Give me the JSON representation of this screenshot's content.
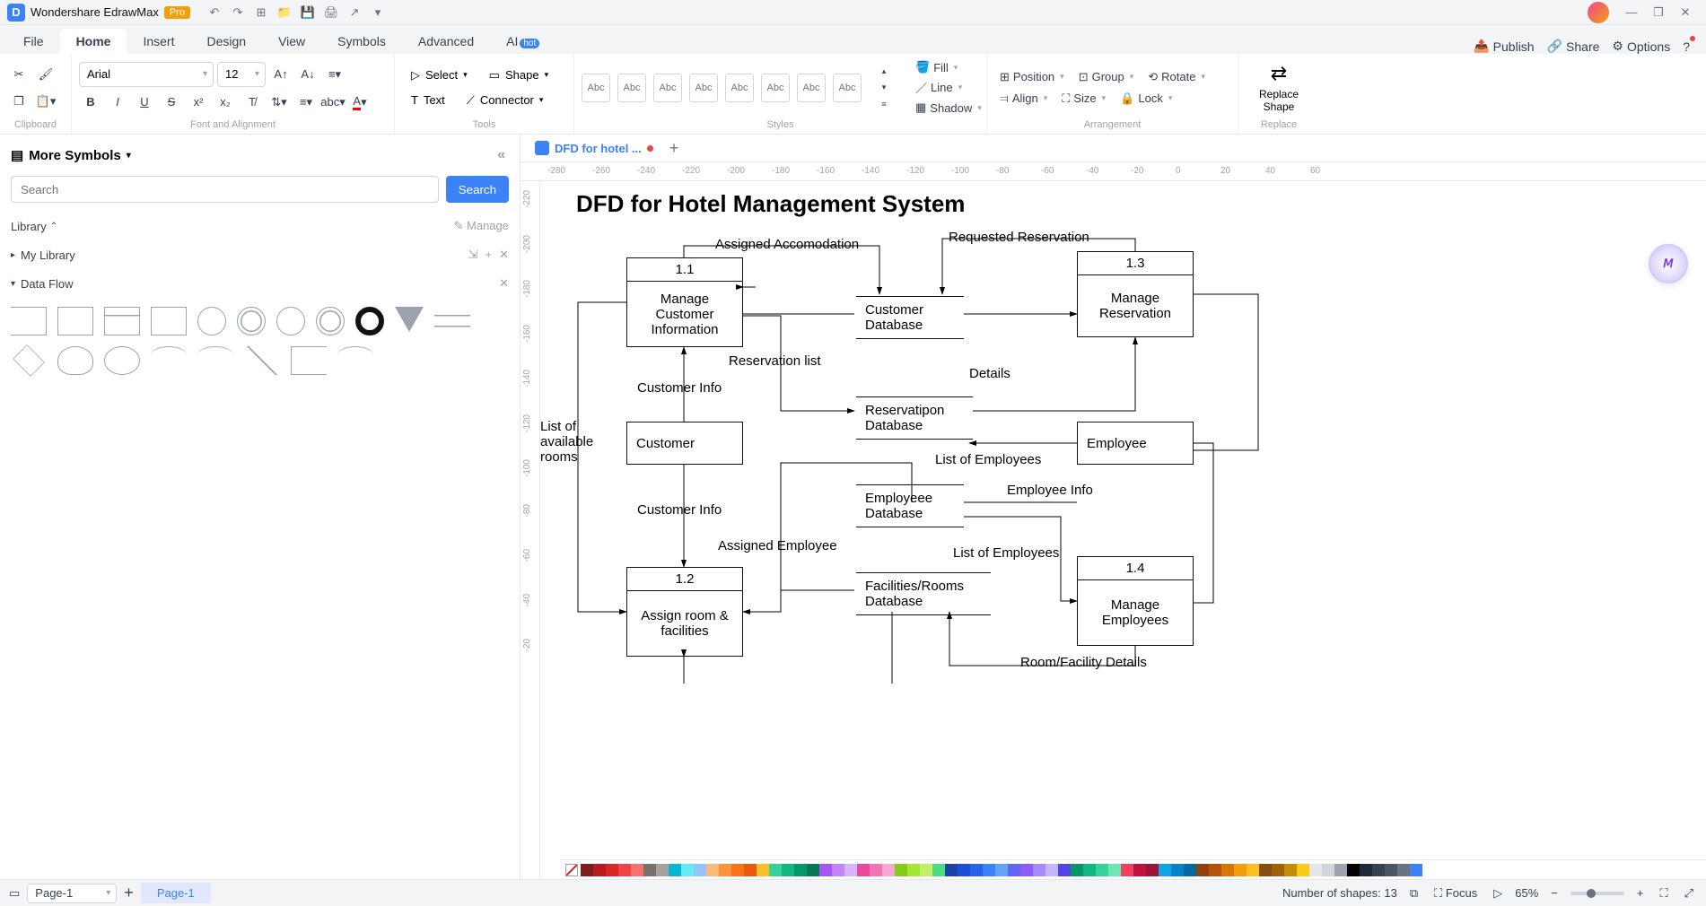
{
  "app": {
    "name": "Wondershare EdrawMax",
    "badge": "Pro"
  },
  "titlebar_icons": [
    "undo",
    "redo",
    "new",
    "open",
    "save",
    "print",
    "export",
    "more"
  ],
  "menu": {
    "items": [
      "File",
      "Home",
      "Insert",
      "Design",
      "View",
      "Symbols",
      "Advanced",
      "AI"
    ],
    "active": "Home",
    "hot_on": "AI",
    "right": {
      "publish": "Publish",
      "share": "Share",
      "options": "Options"
    }
  },
  "ribbon": {
    "clipboard": {
      "label": "Clipboard"
    },
    "font": {
      "label": "Font and Alignment",
      "family": "Arial",
      "size": "12"
    },
    "tools": {
      "label": "Tools",
      "select": "Select",
      "text": "Text",
      "shape": "Shape",
      "connector": "Connector"
    },
    "styles": {
      "label": "Styles",
      "sample": "Abc",
      "count": 8,
      "fill": "Fill",
      "line": "Line",
      "shadow": "Shadow"
    },
    "arrange": {
      "label": "Arrangement",
      "position": "Position",
      "align": "Align",
      "group": "Group",
      "size": "Size",
      "rotate": "Rotate",
      "lock": "Lock"
    },
    "replace": {
      "label": "Replace",
      "btn": "Replace Shape"
    }
  },
  "sidebar": {
    "title": "More Symbols",
    "search_placeholder": "Search",
    "search_btn": "Search",
    "library": "Library",
    "manage": "Manage",
    "mylib": "My Library",
    "section": "Data Flow"
  },
  "tab": {
    "name": "DFD for hotel ...",
    "dirty": true
  },
  "ruler_h": [
    "-280",
    "-260",
    "-240",
    "-220",
    "-200",
    "-180",
    "-160",
    "-140",
    "-120",
    "-100",
    "-80",
    "-60",
    "-40",
    "-20",
    "0",
    "20",
    "40",
    "60"
  ],
  "ruler_v": [
    "-220",
    "-200",
    "-180",
    "-160",
    "-140",
    "-120",
    "-100",
    "-80",
    "-60",
    "-40",
    "-20"
  ],
  "diagram": {
    "title": "DFD for Hotel Management System",
    "processes": {
      "p11": {
        "num": "1.1",
        "label": "Manage Customer Information"
      },
      "p12": {
        "num": "1.2",
        "label": "Assign room & facilities"
      },
      "p13": {
        "num": "1.3",
        "label": "Manage Reservation"
      },
      "p14": {
        "num": "1.4",
        "label": "Manage Employees"
      }
    },
    "entities": {
      "customer": "Customer",
      "employee": "Employee"
    },
    "stores": {
      "custdb": "Customer Database",
      "resdb": "Reservatipon Database",
      "empdb": "Employeee Database",
      "facdb": "Facilities/Rooms Database"
    },
    "flows": {
      "assigned_accom": "Assigned Accomodation",
      "requested_res": "Requested Reservation",
      "reservation_list": "Reservation list",
      "details": "Details",
      "customer_info1": "Customer Info",
      "customer_info2": "Customer Info",
      "list_rooms": "List of available rooms",
      "list_emp1": "List of Employees",
      "list_emp2": "List of Employees",
      "emp_info": "Employee Info",
      "assigned_emp": "Assigned Employee",
      "room_details": "Room/Facility Details"
    }
  },
  "status": {
    "page_sel": "Page-1",
    "page_tab": "Page-1",
    "shapes": "Number of shapes: 13",
    "focus": "Focus",
    "zoom": "65%"
  },
  "colors": [
    "#7f1d1d",
    "#b91c1c",
    "#dc2626",
    "#ef4444",
    "#f87171",
    "#78716c",
    "#a8a29e",
    "#06b6d4",
    "#67e8f9",
    "#93c5fd",
    "#fdba74",
    "#fb923c",
    "#f97316",
    "#ea580c",
    "#fbbf24",
    "#34d399",
    "#10b981",
    "#059669",
    "#047857",
    "#a855f7",
    "#c084fc",
    "#d8b4fe",
    "#ec4899",
    "#f472b6",
    "#f9a8d4",
    "#84cc16",
    "#a3e635",
    "#bef264",
    "#4ade80",
    "#1e40af",
    "#1d4ed8",
    "#2563eb",
    "#3b82f6",
    "#60a5fa",
    "#6366f1",
    "#8b5cf6",
    "#a78bfa",
    "#c4b5fd",
    "#4f46e5",
    "#059669",
    "#10b981",
    "#34d399",
    "#6ee7b7",
    "#f43f5e",
    "#be123c",
    "#9f1239",
    "#0ea5e9",
    "#0284c7",
    "#0369a1",
    "#92400e",
    "#b45309",
    "#d97706",
    "#f59e0b",
    "#fbbf24",
    "#854d0e",
    "#a16207",
    "#ca8a04",
    "#facc15",
    "#e5e7eb",
    "#d1d5db",
    "#9ca3af",
    "#000000",
    "#1f2937",
    "#374151",
    "#4b5563",
    "#6b7280",
    "#3b82f6"
  ]
}
